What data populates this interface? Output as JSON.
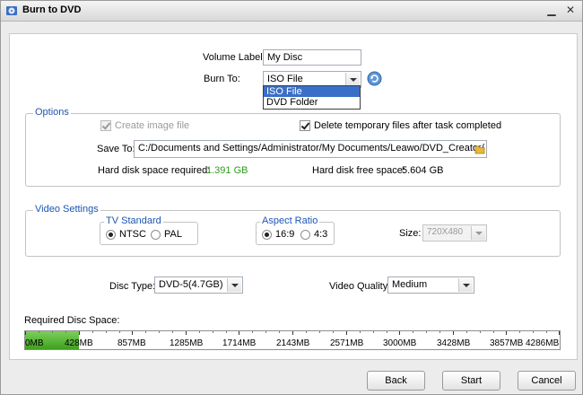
{
  "window": {
    "title": "Burn to DVD",
    "minimize_glyph": "▁",
    "close_glyph": "✕"
  },
  "volume": {
    "label": "Volume Label:",
    "value": "My Disc"
  },
  "burn_to": {
    "label": "Burn To:",
    "selected": "ISO File",
    "options": [
      "ISO File",
      "DVD Folder"
    ]
  },
  "options_group": {
    "title": "Options",
    "create_image": {
      "label": "Create image file",
      "checked": true,
      "disabled": true
    },
    "delete_temp": {
      "label": "Delete temporary files after task completed",
      "checked": true
    },
    "save_to": {
      "label": "Save To:",
      "value": "C:/Documents and Settings/Administrator/My Documents/Leawo/DVD_Creator/"
    },
    "required": {
      "label": "Hard disk space required:",
      "value": "1.391 GB"
    },
    "free": {
      "label": "Hard disk free space:",
      "value": "5.604 GB"
    }
  },
  "video_settings": {
    "title": "Video Settings",
    "tv_standard": {
      "title": "TV Standard",
      "options": [
        "NTSC",
        "PAL"
      ],
      "selected": "NTSC"
    },
    "aspect_ratio": {
      "title": "Aspect Ratio",
      "options": [
        "16:9",
        "4:3"
      ],
      "selected": "16:9"
    },
    "size": {
      "label": "Size:",
      "value": "720X480"
    }
  },
  "disc_type": {
    "label": "Disc Type:",
    "value": "DVD-5(4.7GB)"
  },
  "video_quality": {
    "label": "Video Quality:",
    "value": "Medium"
  },
  "disc_space": {
    "label": "Required Disc Space:",
    "used_fraction": 0.1,
    "ticks": [
      "0MB",
      "428MB",
      "857MB",
      "1285MB",
      "1714MB",
      "2143MB",
      "2571MB",
      "3000MB",
      "3428MB",
      "3857MB",
      "4286MB"
    ]
  },
  "buttons": {
    "back": "Back",
    "start": "Start",
    "cancel": "Cancel"
  },
  "colors": {
    "accent": "#1c55b5",
    "progress": "#3f9f1e",
    "selection": "#3a6fc7"
  }
}
